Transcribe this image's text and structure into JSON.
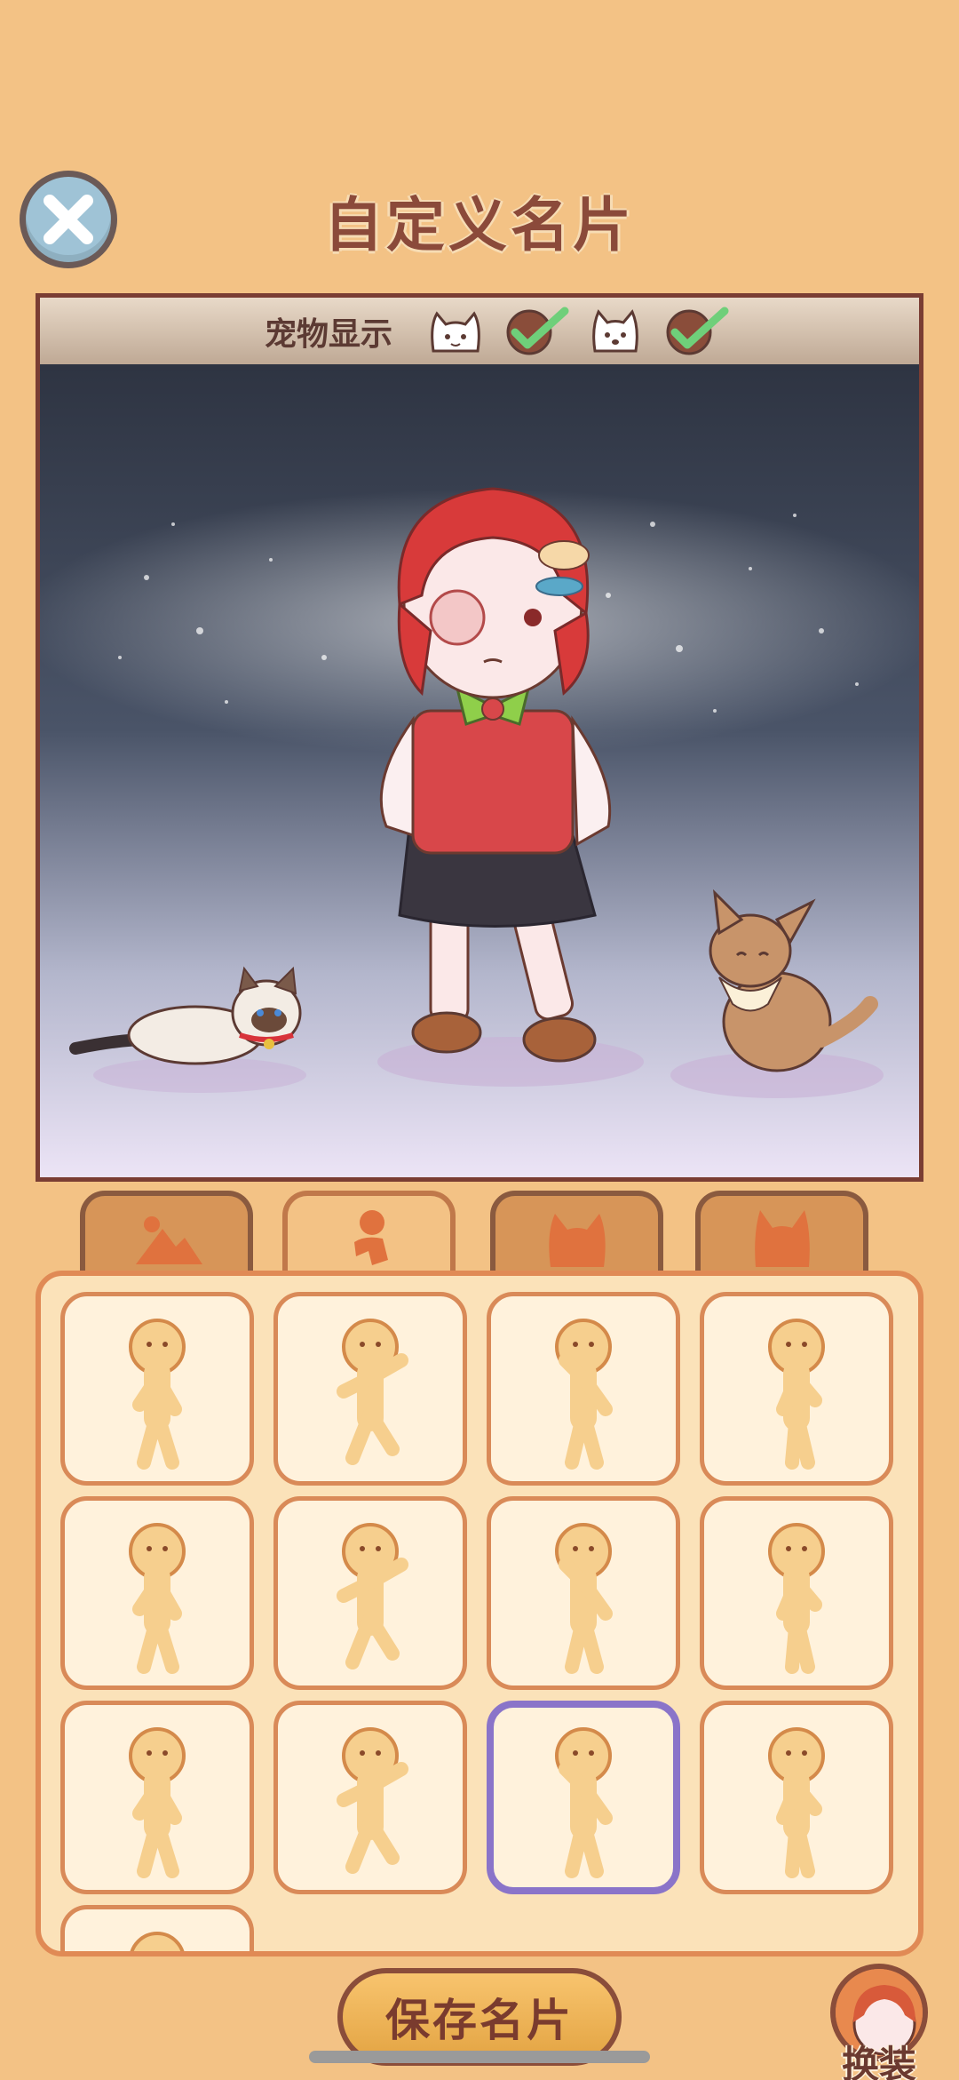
{
  "header": {
    "title": "自定义名片"
  },
  "preview": {
    "pet_display_label": "宠物显示",
    "pets": [
      {
        "icon": "cat-face-icon",
        "checked": true
      },
      {
        "icon": "dog-face-icon",
        "checked": true
      }
    ]
  },
  "tabs": [
    {
      "icon": "background-icon",
      "active": false
    },
    {
      "icon": "pose-icon",
      "active": true
    },
    {
      "icon": "cat-pet-icon",
      "active": false
    },
    {
      "icon": "dog-pet-icon",
      "active": false
    }
  ],
  "poses": {
    "count": 13,
    "selected_index": 10
  },
  "footer": {
    "save_label": "保存名片",
    "dressup_label": "换装"
  },
  "colors": {
    "background": "#f3c285",
    "accent_title": "#8b4a3a",
    "selected_border": "#8a74c9"
  }
}
